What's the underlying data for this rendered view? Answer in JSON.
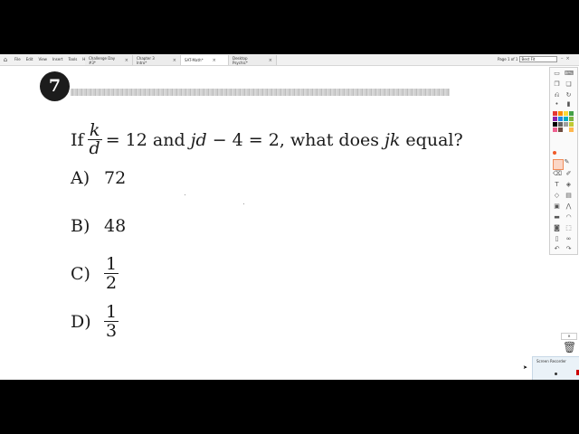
{
  "app": {
    "menus": [
      "File",
      "Edit",
      "View",
      "Insert",
      "Tools",
      "Help"
    ],
    "tabs": [
      {
        "label": "Challenge Day #3*",
        "active": false
      },
      {
        "label": "Chapter 3 Intro*",
        "active": false
      },
      {
        "label": "SAT-Math*",
        "active": true
      },
      {
        "label": "Desktop Psychic*",
        "active": false
      }
    ],
    "page_indicator": "Page 1 of 1",
    "zoom": "Best Fit"
  },
  "question": {
    "number": "7",
    "prefix": "If",
    "frac_num": "k",
    "frac_den": "d",
    "mid1": "= 12 and",
    "jd": "jd",
    "mid2": "− 4 = 2, what does",
    "jk": "jk",
    "suffix": "equal?"
  },
  "options": [
    {
      "label": "A)",
      "value": "72"
    },
    {
      "label": "B)",
      "value": "48"
    },
    {
      "label": "C)",
      "num": "1",
      "den": "2"
    },
    {
      "label": "D)",
      "num": "1",
      "den": "3"
    }
  ],
  "toolbar": {
    "swatch_colors": [
      "#e53935",
      "#fb8c00",
      "#fdd835",
      "#43a047",
      "#8e24aa",
      "#1e88e5",
      "#00acc1",
      "#7cb342",
      "#000000",
      "#616161",
      "#9e9e9e",
      "#c0ca33",
      "#f06292",
      "#6d4c41",
      "#ffffff",
      "#ffb74d"
    ],
    "accent": "#f05a28"
  },
  "recorder": {
    "title": "Screen Recorder"
  }
}
